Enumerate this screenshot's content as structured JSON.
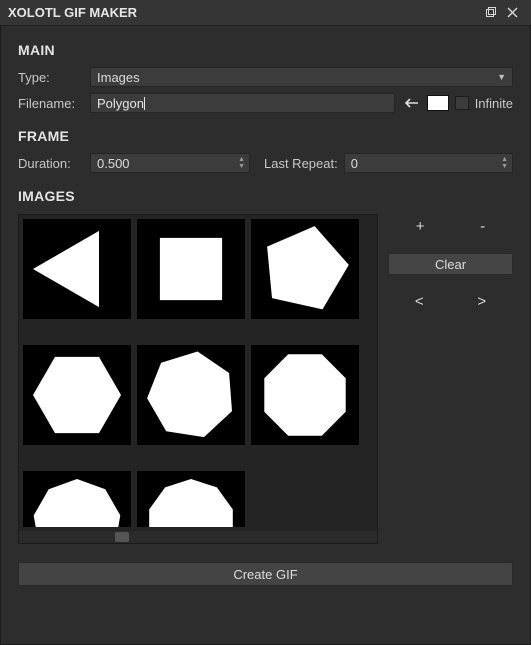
{
  "window": {
    "title": "XOLOTL GIF MAKER"
  },
  "main": {
    "header": "MAIN",
    "type_label": "Type:",
    "type_value": "Images",
    "filename_label": "Filename:",
    "filename_value": "Polygon",
    "infinite_label": "Infinite"
  },
  "frame": {
    "header": "FRAME",
    "duration_label": "Duration:",
    "duration_value": "0.500",
    "last_repeat_label": "Last Repeat:",
    "last_repeat_value": "0"
  },
  "images": {
    "header": "IMAGES",
    "add_label": "+",
    "remove_label": "-",
    "clear_label": "Clear",
    "prev_label": "<",
    "next_label": ">",
    "thumbs": [
      {
        "shape": "triangle"
      },
      {
        "shape": "square"
      },
      {
        "shape": "pentagon"
      },
      {
        "shape": "hexagon"
      },
      {
        "shape": "heptagon"
      },
      {
        "shape": "octagon"
      },
      {
        "shape": "nonagon"
      },
      {
        "shape": "decagon"
      }
    ]
  },
  "action": {
    "create_label": "Create GIF"
  },
  "colors": {
    "swatch": "#ffffff"
  }
}
